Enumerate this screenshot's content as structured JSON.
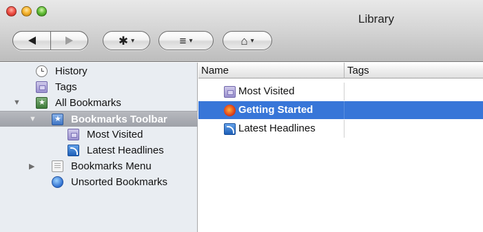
{
  "window": {
    "title": "Library"
  },
  "toolbar": {
    "back_icon": "back-arrow-icon",
    "forward_icon": "forward-arrow-icon",
    "organize_glyph": "✱",
    "views_glyph": "≡",
    "import_glyph": "⌂",
    "dropdown_caret": "▾"
  },
  "sidebar": {
    "items": [
      {
        "label": "History",
        "icon": "history-clock-icon"
      },
      {
        "label": "Tags",
        "icon": "tags-folder-icon"
      },
      {
        "label": "All Bookmarks",
        "icon": "all-bookmarks-icon",
        "disclosure": "▼"
      },
      {
        "label": "Bookmarks Toolbar",
        "icon": "bookmarks-toolbar-icon",
        "disclosure": "▼",
        "selected": true
      },
      {
        "label": "Most Visited",
        "icon": "smart-folder-icon"
      },
      {
        "label": "Latest Headlines",
        "icon": "rss-feed-icon"
      },
      {
        "label": "Bookmarks Menu",
        "icon": "bookmarks-menu-icon",
        "disclosure": "▶"
      },
      {
        "label": "Unsorted Bookmarks",
        "icon": "unsorted-bookmarks-icon"
      }
    ]
  },
  "content": {
    "columns": [
      "Name",
      "Tags"
    ],
    "rows": [
      {
        "name": "Most Visited",
        "icon": "smart-folder-icon",
        "tags": ""
      },
      {
        "name": "Getting Started",
        "icon": "firefox-page-icon",
        "tags": "",
        "selected": true
      },
      {
        "name": "Latest Headlines",
        "icon": "rss-feed-icon",
        "tags": ""
      }
    ]
  },
  "colors": {
    "selection_blue": "#3876d8",
    "sidebar_bg": "#e9edf2",
    "sidebar_selection": "#a3a6ad"
  }
}
